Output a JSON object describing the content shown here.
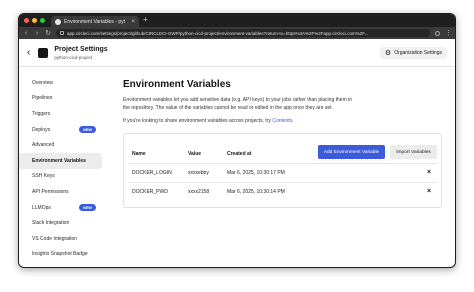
{
  "browser": {
    "tab_title": "Environment Variables - pyt",
    "tab_close": "×",
    "new_tab": "+",
    "url": "app.circleci.com/settings/project/github/CIRCLECI-GWP/python-cicd-project/environment-variables?return-to=https%3A%2F%2Fapp.circleci.com%2F..."
  },
  "project": {
    "title": "Project Settings",
    "subtitle": "python-cicd-project",
    "org_button": "Organization Settings"
  },
  "sidebar": {
    "items": [
      {
        "label": "Overview"
      },
      {
        "label": "Pipelines"
      },
      {
        "label": "Triggers"
      },
      {
        "label": "Deploys",
        "badge": "NEW"
      },
      {
        "label": "Advanced"
      },
      {
        "label": "Environment Variables",
        "active": true
      },
      {
        "label": "SSH Keys"
      },
      {
        "label": "API Permissions"
      },
      {
        "label": "LLMOps",
        "badge": "NEW"
      },
      {
        "label": "Slack Integration"
      },
      {
        "label": "VS Code Integration"
      },
      {
        "label": "Insights Snapshot Badge"
      }
    ]
  },
  "main": {
    "title": "Environment Variables",
    "description": "Environment variables let you add sensitive data (e.g. API keys) to your jobs rather than placing them in the repository. The value of the variables cannot be read or edited in the app once they are set.",
    "share_prefix": "If you're looking to share environment variables across projects, try ",
    "share_link": "Contexts",
    "share_suffix": "."
  },
  "table": {
    "columns": {
      "name": "Name",
      "value": "Value",
      "created": "Created at"
    },
    "add_button": "Add Environment Variable",
    "import_button": "Import Variables",
    "rows": [
      {
        "name": "DOCKER_LOGIN",
        "value": "xxxxebby",
        "created": "Mar 6, 2025, 10:30:17 PM"
      },
      {
        "name": "DOCKER_PWD",
        "value": "xxxx2158",
        "created": "Mar 6, 2025, 10:30:14 PM"
      }
    ],
    "delete_glyph": "×"
  },
  "colors": {
    "accent": "#3b5bdb",
    "badge": "#3b5bdb"
  }
}
